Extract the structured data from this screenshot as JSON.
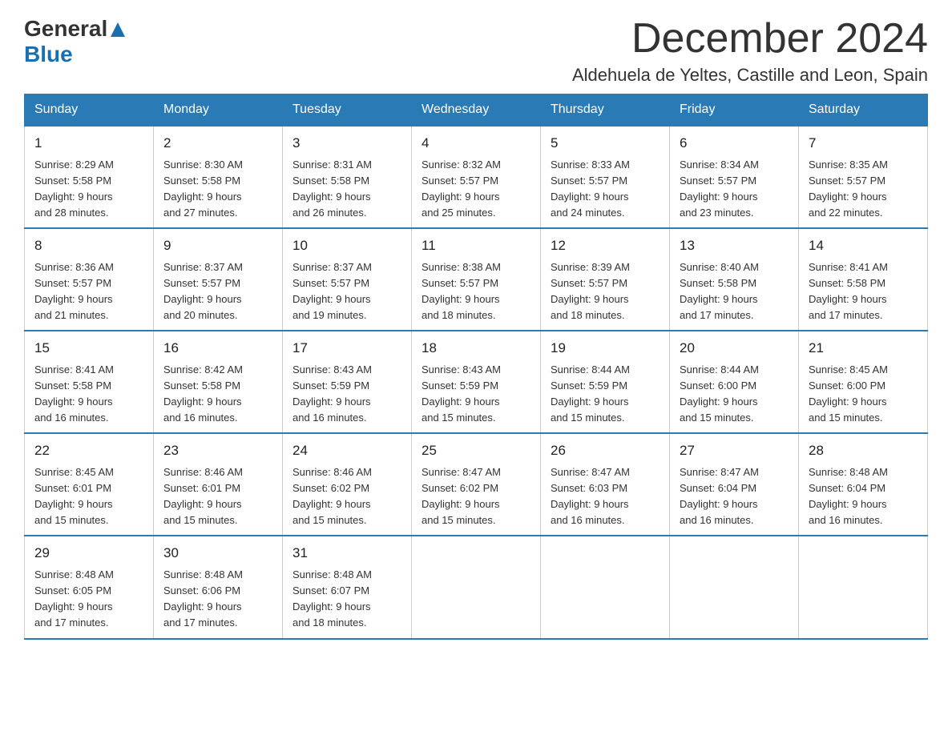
{
  "logo": {
    "general": "General",
    "blue": "Blue",
    "triangle_color": "#1a6faf"
  },
  "title": "December 2024",
  "subtitle": "Aldehuela de Yeltes, Castille and Leon, Spain",
  "days_of_week": [
    "Sunday",
    "Monday",
    "Tuesday",
    "Wednesday",
    "Thursday",
    "Friday",
    "Saturday"
  ],
  "weeks": [
    [
      {
        "day": "1",
        "sunrise": "Sunrise: 8:29 AM",
        "sunset": "Sunset: 5:58 PM",
        "daylight": "Daylight: 9 hours",
        "minutes": "and 28 minutes."
      },
      {
        "day": "2",
        "sunrise": "Sunrise: 8:30 AM",
        "sunset": "Sunset: 5:58 PM",
        "daylight": "Daylight: 9 hours",
        "minutes": "and 27 minutes."
      },
      {
        "day": "3",
        "sunrise": "Sunrise: 8:31 AM",
        "sunset": "Sunset: 5:58 PM",
        "daylight": "Daylight: 9 hours",
        "minutes": "and 26 minutes."
      },
      {
        "day": "4",
        "sunrise": "Sunrise: 8:32 AM",
        "sunset": "Sunset: 5:57 PM",
        "daylight": "Daylight: 9 hours",
        "minutes": "and 25 minutes."
      },
      {
        "day": "5",
        "sunrise": "Sunrise: 8:33 AM",
        "sunset": "Sunset: 5:57 PM",
        "daylight": "Daylight: 9 hours",
        "minutes": "and 24 minutes."
      },
      {
        "day": "6",
        "sunrise": "Sunrise: 8:34 AM",
        "sunset": "Sunset: 5:57 PM",
        "daylight": "Daylight: 9 hours",
        "minutes": "and 23 minutes."
      },
      {
        "day": "7",
        "sunrise": "Sunrise: 8:35 AM",
        "sunset": "Sunset: 5:57 PM",
        "daylight": "Daylight: 9 hours",
        "minutes": "and 22 minutes."
      }
    ],
    [
      {
        "day": "8",
        "sunrise": "Sunrise: 8:36 AM",
        "sunset": "Sunset: 5:57 PM",
        "daylight": "Daylight: 9 hours",
        "minutes": "and 21 minutes."
      },
      {
        "day": "9",
        "sunrise": "Sunrise: 8:37 AM",
        "sunset": "Sunset: 5:57 PM",
        "daylight": "Daylight: 9 hours",
        "minutes": "and 20 minutes."
      },
      {
        "day": "10",
        "sunrise": "Sunrise: 8:37 AM",
        "sunset": "Sunset: 5:57 PM",
        "daylight": "Daylight: 9 hours",
        "minutes": "and 19 minutes."
      },
      {
        "day": "11",
        "sunrise": "Sunrise: 8:38 AM",
        "sunset": "Sunset: 5:57 PM",
        "daylight": "Daylight: 9 hours",
        "minutes": "and 18 minutes."
      },
      {
        "day": "12",
        "sunrise": "Sunrise: 8:39 AM",
        "sunset": "Sunset: 5:57 PM",
        "daylight": "Daylight: 9 hours",
        "minutes": "and 18 minutes."
      },
      {
        "day": "13",
        "sunrise": "Sunrise: 8:40 AM",
        "sunset": "Sunset: 5:58 PM",
        "daylight": "Daylight: 9 hours",
        "minutes": "and 17 minutes."
      },
      {
        "day": "14",
        "sunrise": "Sunrise: 8:41 AM",
        "sunset": "Sunset: 5:58 PM",
        "daylight": "Daylight: 9 hours",
        "minutes": "and 17 minutes."
      }
    ],
    [
      {
        "day": "15",
        "sunrise": "Sunrise: 8:41 AM",
        "sunset": "Sunset: 5:58 PM",
        "daylight": "Daylight: 9 hours",
        "minutes": "and 16 minutes."
      },
      {
        "day": "16",
        "sunrise": "Sunrise: 8:42 AM",
        "sunset": "Sunset: 5:58 PM",
        "daylight": "Daylight: 9 hours",
        "minutes": "and 16 minutes."
      },
      {
        "day": "17",
        "sunrise": "Sunrise: 8:43 AM",
        "sunset": "Sunset: 5:59 PM",
        "daylight": "Daylight: 9 hours",
        "minutes": "and 16 minutes."
      },
      {
        "day": "18",
        "sunrise": "Sunrise: 8:43 AM",
        "sunset": "Sunset: 5:59 PM",
        "daylight": "Daylight: 9 hours",
        "minutes": "and 15 minutes."
      },
      {
        "day": "19",
        "sunrise": "Sunrise: 8:44 AM",
        "sunset": "Sunset: 5:59 PM",
        "daylight": "Daylight: 9 hours",
        "minutes": "and 15 minutes."
      },
      {
        "day": "20",
        "sunrise": "Sunrise: 8:44 AM",
        "sunset": "Sunset: 6:00 PM",
        "daylight": "Daylight: 9 hours",
        "minutes": "and 15 minutes."
      },
      {
        "day": "21",
        "sunrise": "Sunrise: 8:45 AM",
        "sunset": "Sunset: 6:00 PM",
        "daylight": "Daylight: 9 hours",
        "minutes": "and 15 minutes."
      }
    ],
    [
      {
        "day": "22",
        "sunrise": "Sunrise: 8:45 AM",
        "sunset": "Sunset: 6:01 PM",
        "daylight": "Daylight: 9 hours",
        "minutes": "and 15 minutes."
      },
      {
        "day": "23",
        "sunrise": "Sunrise: 8:46 AM",
        "sunset": "Sunset: 6:01 PM",
        "daylight": "Daylight: 9 hours",
        "minutes": "and 15 minutes."
      },
      {
        "day": "24",
        "sunrise": "Sunrise: 8:46 AM",
        "sunset": "Sunset: 6:02 PM",
        "daylight": "Daylight: 9 hours",
        "minutes": "and 15 minutes."
      },
      {
        "day": "25",
        "sunrise": "Sunrise: 8:47 AM",
        "sunset": "Sunset: 6:02 PM",
        "daylight": "Daylight: 9 hours",
        "minutes": "and 15 minutes."
      },
      {
        "day": "26",
        "sunrise": "Sunrise: 8:47 AM",
        "sunset": "Sunset: 6:03 PM",
        "daylight": "Daylight: 9 hours",
        "minutes": "and 16 minutes."
      },
      {
        "day": "27",
        "sunrise": "Sunrise: 8:47 AM",
        "sunset": "Sunset: 6:04 PM",
        "daylight": "Daylight: 9 hours",
        "minutes": "and 16 minutes."
      },
      {
        "day": "28",
        "sunrise": "Sunrise: 8:48 AM",
        "sunset": "Sunset: 6:04 PM",
        "daylight": "Daylight: 9 hours",
        "minutes": "and 16 minutes."
      }
    ],
    [
      {
        "day": "29",
        "sunrise": "Sunrise: 8:48 AM",
        "sunset": "Sunset: 6:05 PM",
        "daylight": "Daylight: 9 hours",
        "minutes": "and 17 minutes."
      },
      {
        "day": "30",
        "sunrise": "Sunrise: 8:48 AM",
        "sunset": "Sunset: 6:06 PM",
        "daylight": "Daylight: 9 hours",
        "minutes": "and 17 minutes."
      },
      {
        "day": "31",
        "sunrise": "Sunrise: 8:48 AM",
        "sunset": "Sunset: 6:07 PM",
        "daylight": "Daylight: 9 hours",
        "minutes": "and 18 minutes."
      },
      null,
      null,
      null,
      null
    ]
  ]
}
